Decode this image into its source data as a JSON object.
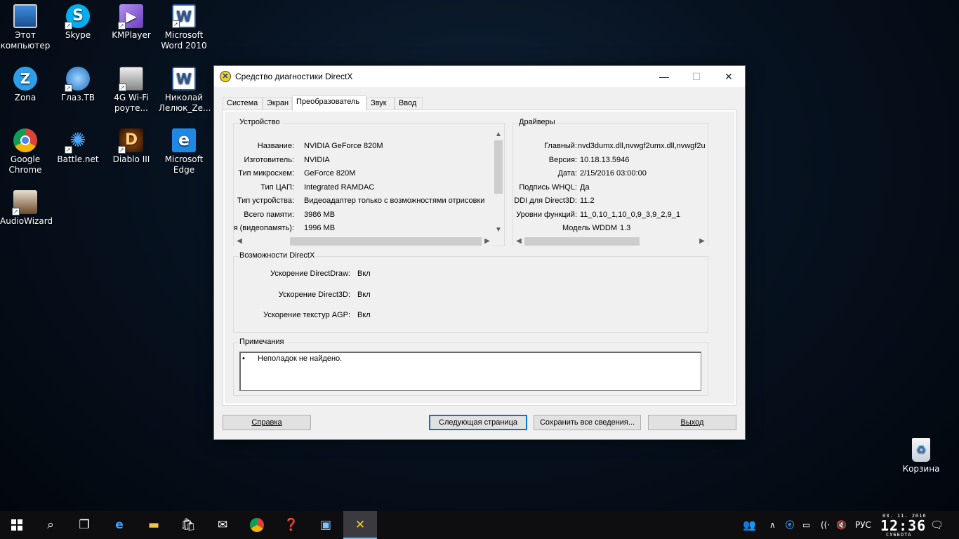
{
  "desktop": {
    "icons": [
      {
        "label": "Этот компьютер"
      },
      {
        "label": "Skype"
      },
      {
        "label": "KMPlayer"
      },
      {
        "label": "Microsoft Word 2010"
      },
      {
        "label": "Zona"
      },
      {
        "label": "Глаз.ТВ"
      },
      {
        "label": "4G Wi-Fi роуте..."
      },
      {
        "label": "Николай Лелюк_Ze..."
      },
      {
        "label": "Google Chrome"
      },
      {
        "label": "Battle.net"
      },
      {
        "label": "Diablo III"
      },
      {
        "label": "Microsoft Edge"
      },
      {
        "label": "AudioWizard"
      },
      {
        "label": "Корзина"
      }
    ]
  },
  "window": {
    "title": "Средство диагностики DirectX",
    "tabs": [
      "Система",
      "Экран",
      "Преобразователь",
      "Звук",
      "Ввод"
    ],
    "active_tab": "Преобразователь",
    "device": {
      "group_title": "Устройство",
      "rows": [
        {
          "label": "Название:",
          "value": "NVIDIA GeForce 820M"
        },
        {
          "label": "Изготовитель:",
          "value": "NVIDIA"
        },
        {
          "label": "Тип микросхем:",
          "value": "GeForce 820M"
        },
        {
          "label": "Тип ЦАП:",
          "value": "Integrated RAMDAC"
        },
        {
          "label": "Тип устройства:",
          "value": "Видеоадаптер только с возможностями отрисовки"
        },
        {
          "label": "Всего памяти:",
          "value": "3986 MB"
        },
        {
          "label": "я (видеопамять):",
          "value": "1996 MB"
        }
      ]
    },
    "drivers": {
      "group_title": "Драйверы",
      "rows": [
        {
          "label": "Главный:",
          "value": "nvd3dumx.dll,nvwgf2umx.dll,nvwgf2u"
        },
        {
          "label": "Версия:",
          "value": "10.18.13.5946"
        },
        {
          "label": "Дата:",
          "value": "2/15/2016 03:00:00"
        },
        {
          "label": "Подпись WHQL:",
          "value": "Да"
        },
        {
          "label": "DDI для Direct3D:",
          "value": "11.2"
        },
        {
          "label": "Уровни функций:",
          "value": "11_0,10_1,10_0,9_3,9_2,9_1"
        },
        {
          "label": "Модель WDDM",
          "value": "1.3"
        }
      ]
    },
    "features": {
      "group_title": "Возможности DirectX",
      "rows": [
        {
          "label": "Ускорение DirectDraw:",
          "value": "Вкл"
        },
        {
          "label": "Ускорение Direct3D:",
          "value": "Вкл"
        },
        {
          "label": "Ускорение текстур AGP:",
          "value": "Вкл"
        }
      ]
    },
    "notes": {
      "group_title": "Примечания",
      "bullet": "•",
      "text": "Неполадок не найдено."
    },
    "buttons": {
      "help": "Справка",
      "next_page": "Следующая страница",
      "save_all": "Сохранить все сведения...",
      "exit": "Выход"
    }
  },
  "taskbar": {
    "language": "РУС",
    "date": "03. 11. 2016",
    "time": "12:36",
    "day": "СУББОТА"
  }
}
